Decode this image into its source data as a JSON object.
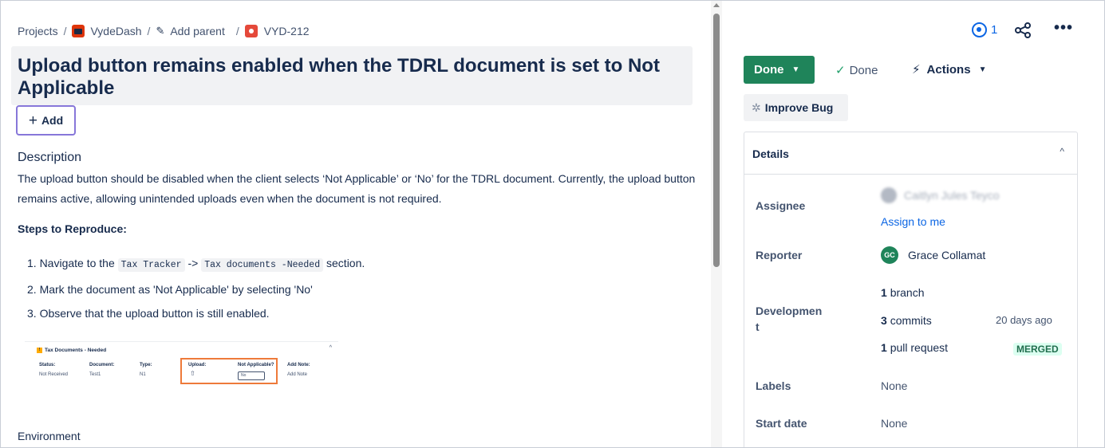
{
  "breadcrumb": {
    "projects": "Projects",
    "project_name": "VydeDash",
    "add_parent": "Add parent",
    "issue_key": "VYD-212",
    "separator": "/"
  },
  "issue": {
    "title": "Upload button remains enabled when the TDRL document is set to Not Applicable",
    "add_label": "Add"
  },
  "description": {
    "heading": "Description",
    "text": "The upload button should be disabled when the client selects ‘Not Applicable’ or ‘No’ for the TDRL document. Currently, the upload button remains active, allowing unintended uploads even when the document is not required.",
    "steps_heading": "Steps to Reproduce:",
    "step1_prefix": "1. Navigate to the ",
    "step1_code1": "Tax Tracker",
    "step1_arrow": " -> ",
    "step1_code2": "Tax documents -Needed",
    "step1_suffix": " section.",
    "step2": "2. Mark the document as 'Not Applicable' by selecting 'No'",
    "step3": "3. Observe that the upload button is still enabled.",
    "environment_heading": "Environment"
  },
  "thumbnail": {
    "title": "Tax Documents - Needed",
    "warn": "!",
    "headers": [
      "Status:",
      "Document:",
      "Type:",
      "Upload:",
      "Not Applicable?",
      "Add Note:"
    ],
    "row": [
      "Not Received",
      "Test1",
      "N1",
      "",
      "No",
      "Add Note"
    ]
  },
  "toolbar": {
    "watch_count": "1",
    "more": "•••"
  },
  "status": {
    "button_label": "Done",
    "state_label": "Done",
    "actions_label": "Actions",
    "improve_label": "Improve Bug"
  },
  "details": {
    "heading": "Details",
    "assignee_label": "Assignee",
    "assignee_value": "Caitlyn Jules Teyco",
    "assign_to_me": "Assign to me",
    "reporter_label": "Reporter",
    "reporter_initials": "GC",
    "reporter_name": "Grace Collamat",
    "development_label_1": "Developmen",
    "development_label_2": "t",
    "branch_count": "1",
    "branch_label": "branch",
    "commit_count": "3",
    "commit_label": "commits",
    "commit_ago": "20 days ago",
    "pr_count": "1",
    "pr_label": "pull request",
    "pr_status": "MERGED",
    "labels_label": "Labels",
    "labels_value": "None",
    "start_date_label": "Start date",
    "start_date_value": "None"
  },
  "colors": {
    "done_green": "#1f845a",
    "link_blue": "#0c66e4",
    "merged_bg": "#dcfff1",
    "highlight_orange": "#ee7a3a",
    "focus_purple": "#8777d9"
  }
}
